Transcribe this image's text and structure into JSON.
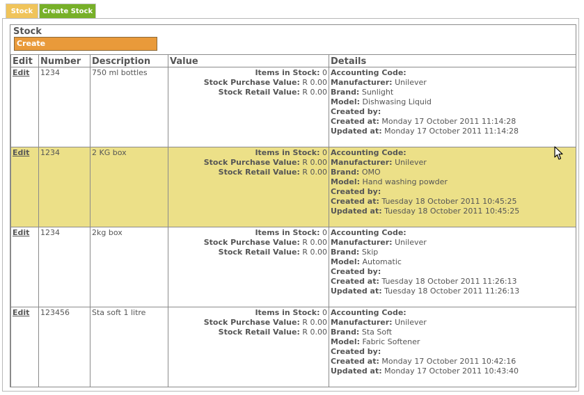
{
  "tabs": [
    {
      "label": "Stock"
    },
    {
      "label": "Create Stock"
    }
  ],
  "panel": {
    "title": "Stock",
    "create_label": "Create"
  },
  "table": {
    "headers": {
      "edit": "Edit",
      "number": "Number",
      "description": "Description",
      "value": "Value",
      "details": "Details"
    },
    "rows": [
      {
        "edit": "Edit",
        "number": "1234",
        "description": "750 ml bottles",
        "items_in_stock_label": "Items in Stock:",
        "items_in_stock": "0",
        "purchase_label": "Stock Purchase Value:",
        "purchase": "R 0.00",
        "retail_label": "Stock Retail Value:",
        "retail": "R 0.00",
        "accounting_code_label": "Accounting Code:",
        "accounting_code": "",
        "manufacturer_label": "Manufacturer:",
        "manufacturer": "Unilever",
        "brand_label": "Brand:",
        "brand": "Sunlight",
        "model_label": "Model:",
        "model": "Dishwasing Liquid",
        "created_by_label": "Created by:",
        "created_by": "",
        "created_at_label": "Created at:",
        "created_at": "Monday 17 October 2011 11:14:28",
        "updated_at_label": "Updated at:",
        "updated_at": "Monday 17 October 2011 11:14:28"
      },
      {
        "edit": "Edit",
        "number": "1234",
        "description": "2 KG box",
        "items_in_stock_label": "Items in Stock:",
        "items_in_stock": "0",
        "purchase_label": "Stock Purchase Value:",
        "purchase": "R 0.00",
        "retail_label": "Stock Retail Value:",
        "retail": "R 0.00",
        "accounting_code_label": "Accounting Code:",
        "accounting_code": "",
        "manufacturer_label": "Manufacturer:",
        "manufacturer": "Unilever",
        "brand_label": "Brand:",
        "brand": "OMO",
        "model_label": "Model:",
        "model": "Hand washing powder",
        "created_by_label": "Created by:",
        "created_by": "",
        "created_at_label": "Created at:",
        "created_at": "Tuesday 18 October 2011 10:45:25",
        "updated_at_label": "Updated at:",
        "updated_at": "Tuesday 18 October 2011 10:45:25"
      },
      {
        "edit": "Edit",
        "number": "1234",
        "description": "2kg box",
        "items_in_stock_label": "Items in Stock:",
        "items_in_stock": "0",
        "purchase_label": "Stock Purchase Value:",
        "purchase": "R 0.00",
        "retail_label": "Stock Retail Value:",
        "retail": "R 0.00",
        "accounting_code_label": "Accounting Code:",
        "accounting_code": "",
        "manufacturer_label": "Manufacturer:",
        "manufacturer": "Unilever",
        "brand_label": "Brand:",
        "brand": "Skip",
        "model_label": "Model:",
        "model": "Automatic",
        "created_by_label": "Created by:",
        "created_by": "",
        "created_at_label": "Created at:",
        "created_at": "Tuesday 18 October 2011 11:26:13",
        "updated_at_label": "Updated at:",
        "updated_at": "Tuesday 18 October 2011 11:26:13"
      },
      {
        "edit": "Edit",
        "number": "123456",
        "description": "Sta soft 1 litre",
        "items_in_stock_label": "Items in Stock:",
        "items_in_stock": "0",
        "purchase_label": "Stock Purchase Value:",
        "purchase": "R 0.00",
        "retail_label": "Stock Retail Value:",
        "retail": "R 0.00",
        "accounting_code_label": "Accounting Code:",
        "accounting_code": "",
        "manufacturer_label": "Manufacturer:",
        "manufacturer": "Unilever",
        "brand_label": "Brand:",
        "brand": "Sta Soft",
        "model_label": "Model:",
        "model": "Fabric Softener",
        "created_by_label": "Created by:",
        "created_by": "",
        "created_at_label": "Created at:",
        "created_at": "Monday 17 October 2011 10:42:16",
        "updated_at_label": "Updated at:",
        "updated_at": "Monday 17 October 2011 10:43:40"
      }
    ]
  },
  "colors": {
    "tab_stock": "#f0c45a",
    "tab_create": "#77b028",
    "create_button": "#e99a3a",
    "row_highlight": "#ece088"
  }
}
